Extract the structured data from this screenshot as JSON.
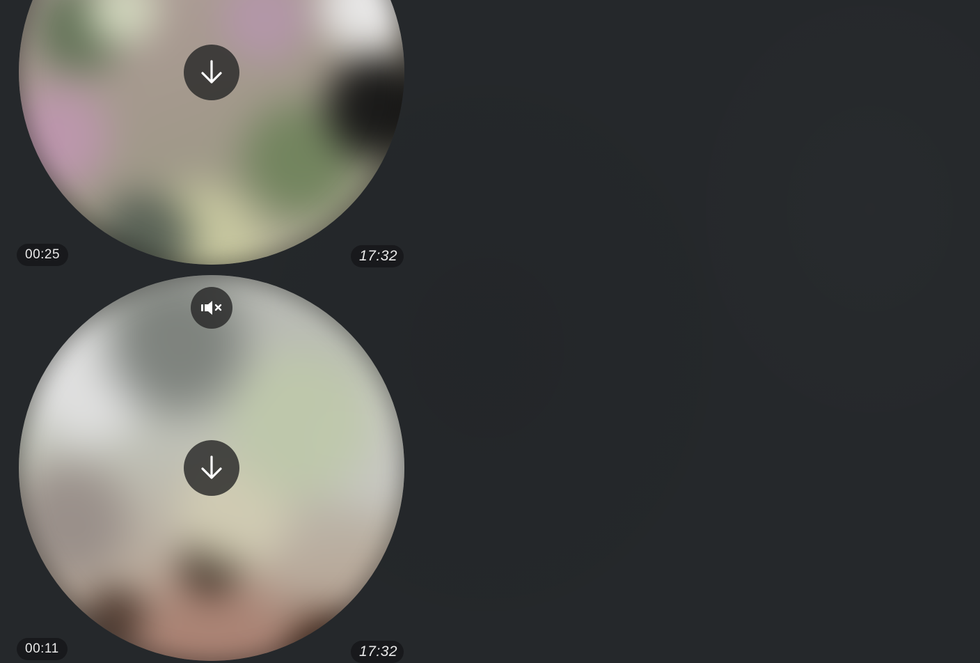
{
  "messages": [
    {
      "duration": "00:25",
      "time": "17:32",
      "download_icon": "arrow-down-icon"
    },
    {
      "duration": "00:11",
      "time": "17:32",
      "download_icon": "arrow-down-icon",
      "mute_icon": "speaker-muted-icon"
    }
  ],
  "colors": {
    "background": "#25282b",
    "overlay_button": "#282828",
    "badge_bg": "#141618",
    "badge_text": "#e8e8e8"
  }
}
